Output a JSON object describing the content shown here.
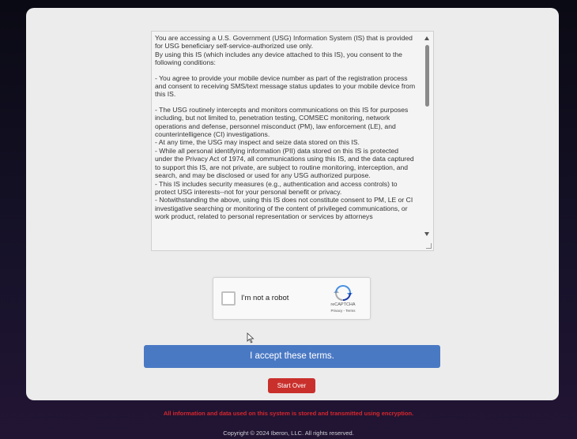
{
  "terms": {
    "paragraphs": [
      "You are accessing a U.S. Government (USG) Information System (IS) that is provided for USG beneficiary self-service-authorized use only.",
      "By using this IS (which includes any device attached to this IS), you consent to the following conditions:",
      "",
      "- You agree to provide your mobile device number as part of the registration process and consent to receiving SMS/text message status updates to your mobile device from this IS.",
      "",
      "- The USG routinely intercepts and monitors communications on this IS for purposes including, but not limited to, penetration testing, COMSEC monitoring, network operations and defense, personnel misconduct (PM), law enforcement (LE), and counterintelligence (CI) investigations.",
      "- At any time, the USG may inspect and seize data stored on this IS.",
      "- While all personal identifying information (PII) data stored on this IS is protected under the Privacy Act of 1974, all communications using this IS, and the data captured to support this IS, are not private, are subject to routine monitoring, interception, and search, and may be disclosed or used for any USG authorized purpose.",
      "- This IS includes security measures (e.g., authentication and access controls) to protect USG interests--not for your personal benefit or privacy.",
      "- Notwithstanding the above, using this IS does not constitute consent to PM, LE or CI investigative searching or monitoring of the content of privileged communications, or work product, related to personal representation or services by attorneys"
    ]
  },
  "recaptcha": {
    "label": "I'm not a robot",
    "brand": "reCAPTCHA",
    "links": "Privacy - Terms"
  },
  "buttons": {
    "accept": "I accept these terms.",
    "start_over": "Start Over"
  },
  "footer": {
    "notice": "All information and data used on this system is stored and transmitted using encryption.",
    "copyright": "Copyright © 2024 Iberon, LLC. All rights reserved."
  },
  "colors": {
    "accept_button": "#4a79c4",
    "start_over_button": "#c9302c",
    "notice_text": "#d6262e"
  }
}
